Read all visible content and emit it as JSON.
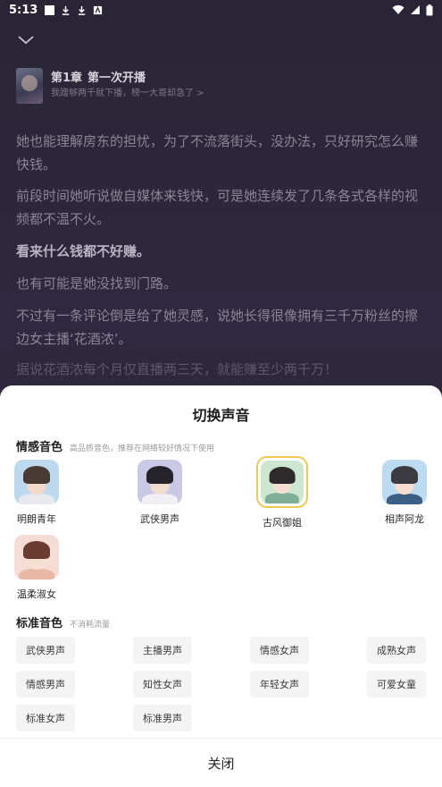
{
  "status_bar": {
    "time": "5:13"
  },
  "chapter": {
    "number": "第1章",
    "title": "第一次开播",
    "subtitle": "我蹭够两千就下播，榜一大哥却急了 >"
  },
  "paragraphs": [
    "她也能理解房东的担忧，为了不流落街头，没办法，只好研究怎么赚快钱。",
    "前段时间她听说做自媒体来钱快，可是她连续发了几条各式各样的视频都不温不火。",
    "看来什么钱都不好赚。",
    "也有可能是她没找到门路。",
    "不过有一条评论倒是给了她灵感，说她长得很像拥有三千万粉丝的擦边女主播‘花酒浓’。",
    "据说花酒浓每个月仅直播两三天，就能赚至少两千万！"
  ],
  "sheet": {
    "title": "切换声音",
    "emotional": {
      "title": "情感音色",
      "desc": "高品质音色，推荐在网络较好情况下使用",
      "voices": [
        {
          "label": "明朗青年",
          "icon": "young-man-avatar-icon",
          "selected": false
        },
        {
          "label": "武侠男声",
          "icon": "swordsman-avatar-icon",
          "selected": false
        },
        {
          "label": "古风御姐",
          "icon": "ancient-lady-avatar-icon",
          "selected": true
        },
        {
          "label": "相声阿龙",
          "icon": "crosstalk-man-avatar-icon",
          "selected": false
        },
        {
          "label": "温柔淑女",
          "icon": "gentle-lady-avatar-icon",
          "selected": false
        }
      ]
    },
    "standard": {
      "title": "标准音色",
      "desc": "不消耗流量",
      "options": [
        "武侠男声",
        "主播男声",
        "情感女声",
        "成熟女声",
        "情感男声",
        "知性女声",
        "年轻女声",
        "可爱女童",
        "标准女声",
        "标准男声"
      ]
    },
    "close_label": "关闭"
  },
  "colors": {
    "accent_border": "#f1c94f",
    "sheet_bg": "#ffffff",
    "reader_bg": "#2b2739"
  }
}
